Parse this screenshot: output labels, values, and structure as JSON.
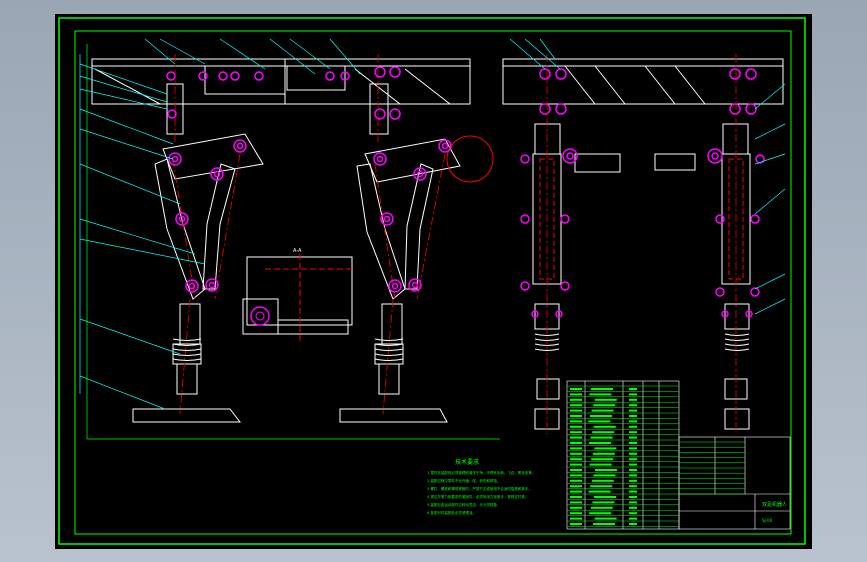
{
  "drawing": {
    "tech_requirements_title": "技术要求",
    "tech_requirements_lines": [
      "1.零件在装配前必须清理和清洗干净，不得有毛刺、飞边、氧化皮等。",
      "2.装配过程中零件不允许磕、碰、划伤和锈蚀。",
      "3.螺钉、螺栓和螺母紧固时，严禁打击或使用不合适的旋具和扳手。",
      "4.规定拧紧力矩要求的紧固件，必须采用力矩扳手，按规定拧紧。",
      "5.装配后各运动部件应转动灵活，无卡滞现象。",
      "6.各密封件装配前必须浸透油。"
    ],
    "title_block_name": "双足机器人",
    "title_block_drawing_no": "SJ-00",
    "section_label": "A-A",
    "colors": {
      "frame": "#00ff00",
      "outline": "#ffffff",
      "center_line": "#ff0000",
      "joint": "#ff00ff",
      "leader": "#00ffff",
      "ground": "#000000"
    }
  }
}
